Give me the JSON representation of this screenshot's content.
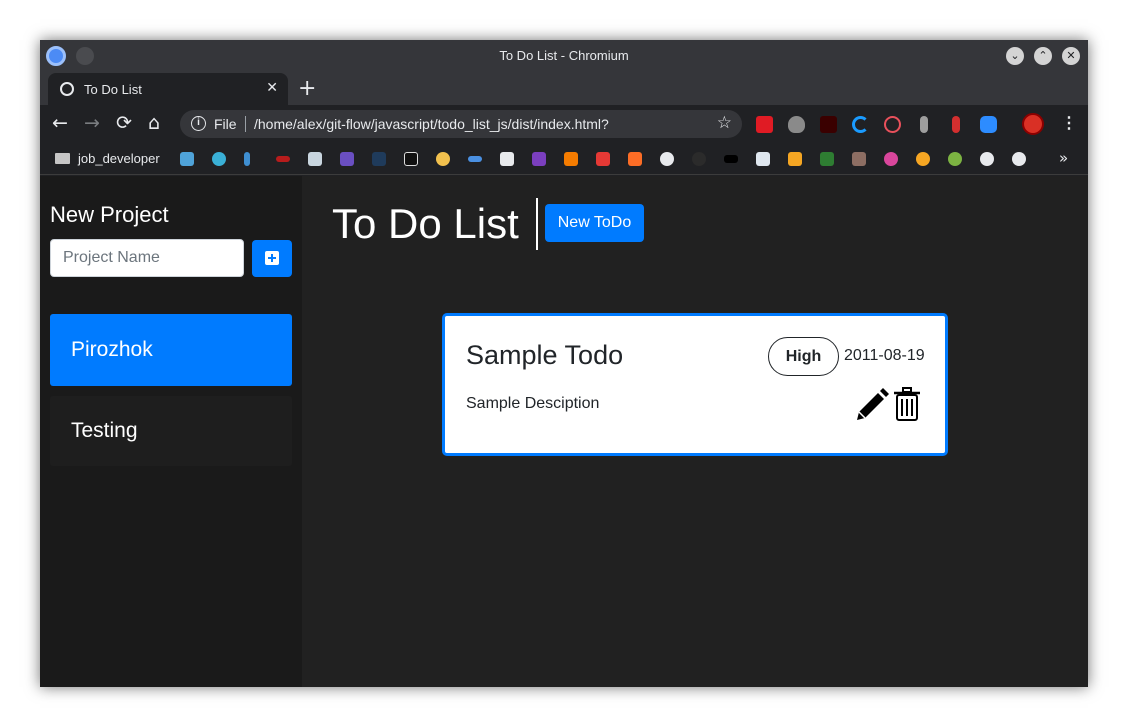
{
  "window": {
    "title": "To Do List - Chromium"
  },
  "tab": {
    "label": "To Do List",
    "close": "✕"
  },
  "newtab": "+",
  "toolbar": {
    "back": "←",
    "forward": "→",
    "reload": "⟳",
    "home": "⌂",
    "scheme": "File",
    "url": "/home/alex/git-flow/javascript/todo_list_js/dist/index.html?",
    "star": "☆",
    "menu": "⋮"
  },
  "bookmarks": {
    "folder_label": "job_developer",
    "overflow": "»"
  },
  "sidebar": {
    "title": "New Project",
    "input_placeholder": "Project Name",
    "projects": [
      {
        "name": "Pirozhok",
        "active": true
      },
      {
        "name": "Testing",
        "active": false
      }
    ]
  },
  "header": {
    "title": "To Do List",
    "new_todo_label": "New ToDo"
  },
  "todo": {
    "title": "Sample Todo",
    "priority": "High",
    "due_date": "2011-08-19",
    "description": "Sample Desciption"
  },
  "colors": {
    "accent": "#007bff",
    "page_bg": "#212121",
    "sidebar_bg": "#1a1a1a"
  },
  "icons": [
    "chromium-logo",
    "globe-icon",
    "info-icon",
    "star-icon",
    "folder-icon",
    "plus-square-icon",
    "pencil-icon",
    "trash-icon"
  ]
}
